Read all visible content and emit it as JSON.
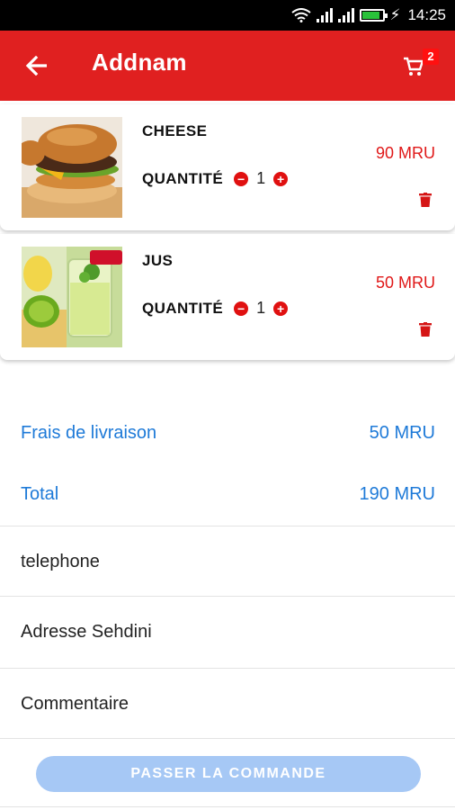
{
  "status_bar": {
    "time": "14:25"
  },
  "app_bar": {
    "title": "Addnam",
    "cart_count": "2"
  },
  "cart_items": [
    {
      "name": "CHEESE",
      "quantity_label": "QUANTITÉ",
      "quantity": "1",
      "price": "90 MRU"
    },
    {
      "name": "JUS",
      "quantity_label": "QUANTITÉ",
      "quantity": "1",
      "price": "50 MRU"
    }
  ],
  "summary": {
    "delivery_label": "Frais de livraison",
    "delivery_value": "50 MRU",
    "total_label": "Total",
    "total_value": "190 MRU"
  },
  "form": {
    "phone_placeholder": "telephone",
    "address_placeholder": "Adresse Sehdini",
    "comment_placeholder": "Commentaire"
  },
  "submit_label": "PASSER LA COMMANDE",
  "icons": {
    "back": "arrow-left-icon",
    "cart": "cart-icon",
    "minus": "minus-circle-icon",
    "plus": "plus-circle-icon",
    "delete": "trash-icon"
  },
  "colors": {
    "accent": "#e02020",
    "price": "#e01818",
    "summary_text": "#1e7ad8",
    "button_disabled": "#a6c8f5"
  }
}
